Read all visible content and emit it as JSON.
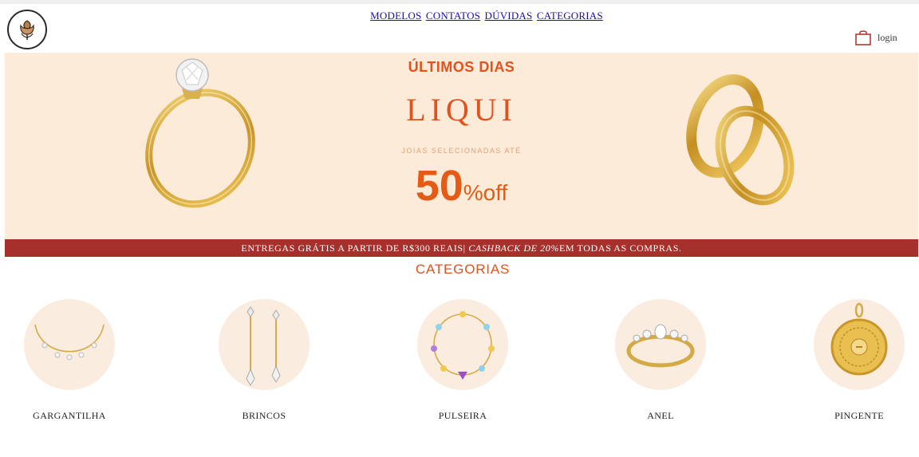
{
  "header": {
    "nav": [
      {
        "label": "MODELOS"
      },
      {
        "label": "CONTATOS"
      },
      {
        "label": "DÚVIDAS"
      },
      {
        "label": "CATEGORIAS"
      }
    ],
    "login_label": "login",
    "logo_icon": "rose-logo-icon",
    "bag_icon": "shopping-bag-icon"
  },
  "banner": {
    "title": "ÚLTIMOS DIAS",
    "brand": "LIQUI",
    "subtitle": "JOIAS SELECIONADAS ATÉ",
    "discount_number": "50",
    "discount_suffix": "%off",
    "accent_color": "#e0531f",
    "background_color": "#fcebd9"
  },
  "shipping_bar": {
    "text_before": "ENTREGAS GRÁTIS A PARTIR DE R$300 REAIS| ",
    "text_italic": "CASHBACK DE 20%",
    "text_after": "EM TODAS AS COMPRAS.",
    "background_color": "#a6302c"
  },
  "categories": {
    "title": "CATEGORIAS",
    "items": [
      {
        "label": "GARGANTILHA",
        "icon": "necklace-icon"
      },
      {
        "label": "BRINCOS",
        "icon": "earrings-icon"
      },
      {
        "label": "PULSEIRA",
        "icon": "bracelet-icon"
      },
      {
        "label": "ANEL",
        "icon": "ring-icon"
      },
      {
        "label": "PINGENTE",
        "icon": "pendant-icon"
      }
    ]
  }
}
